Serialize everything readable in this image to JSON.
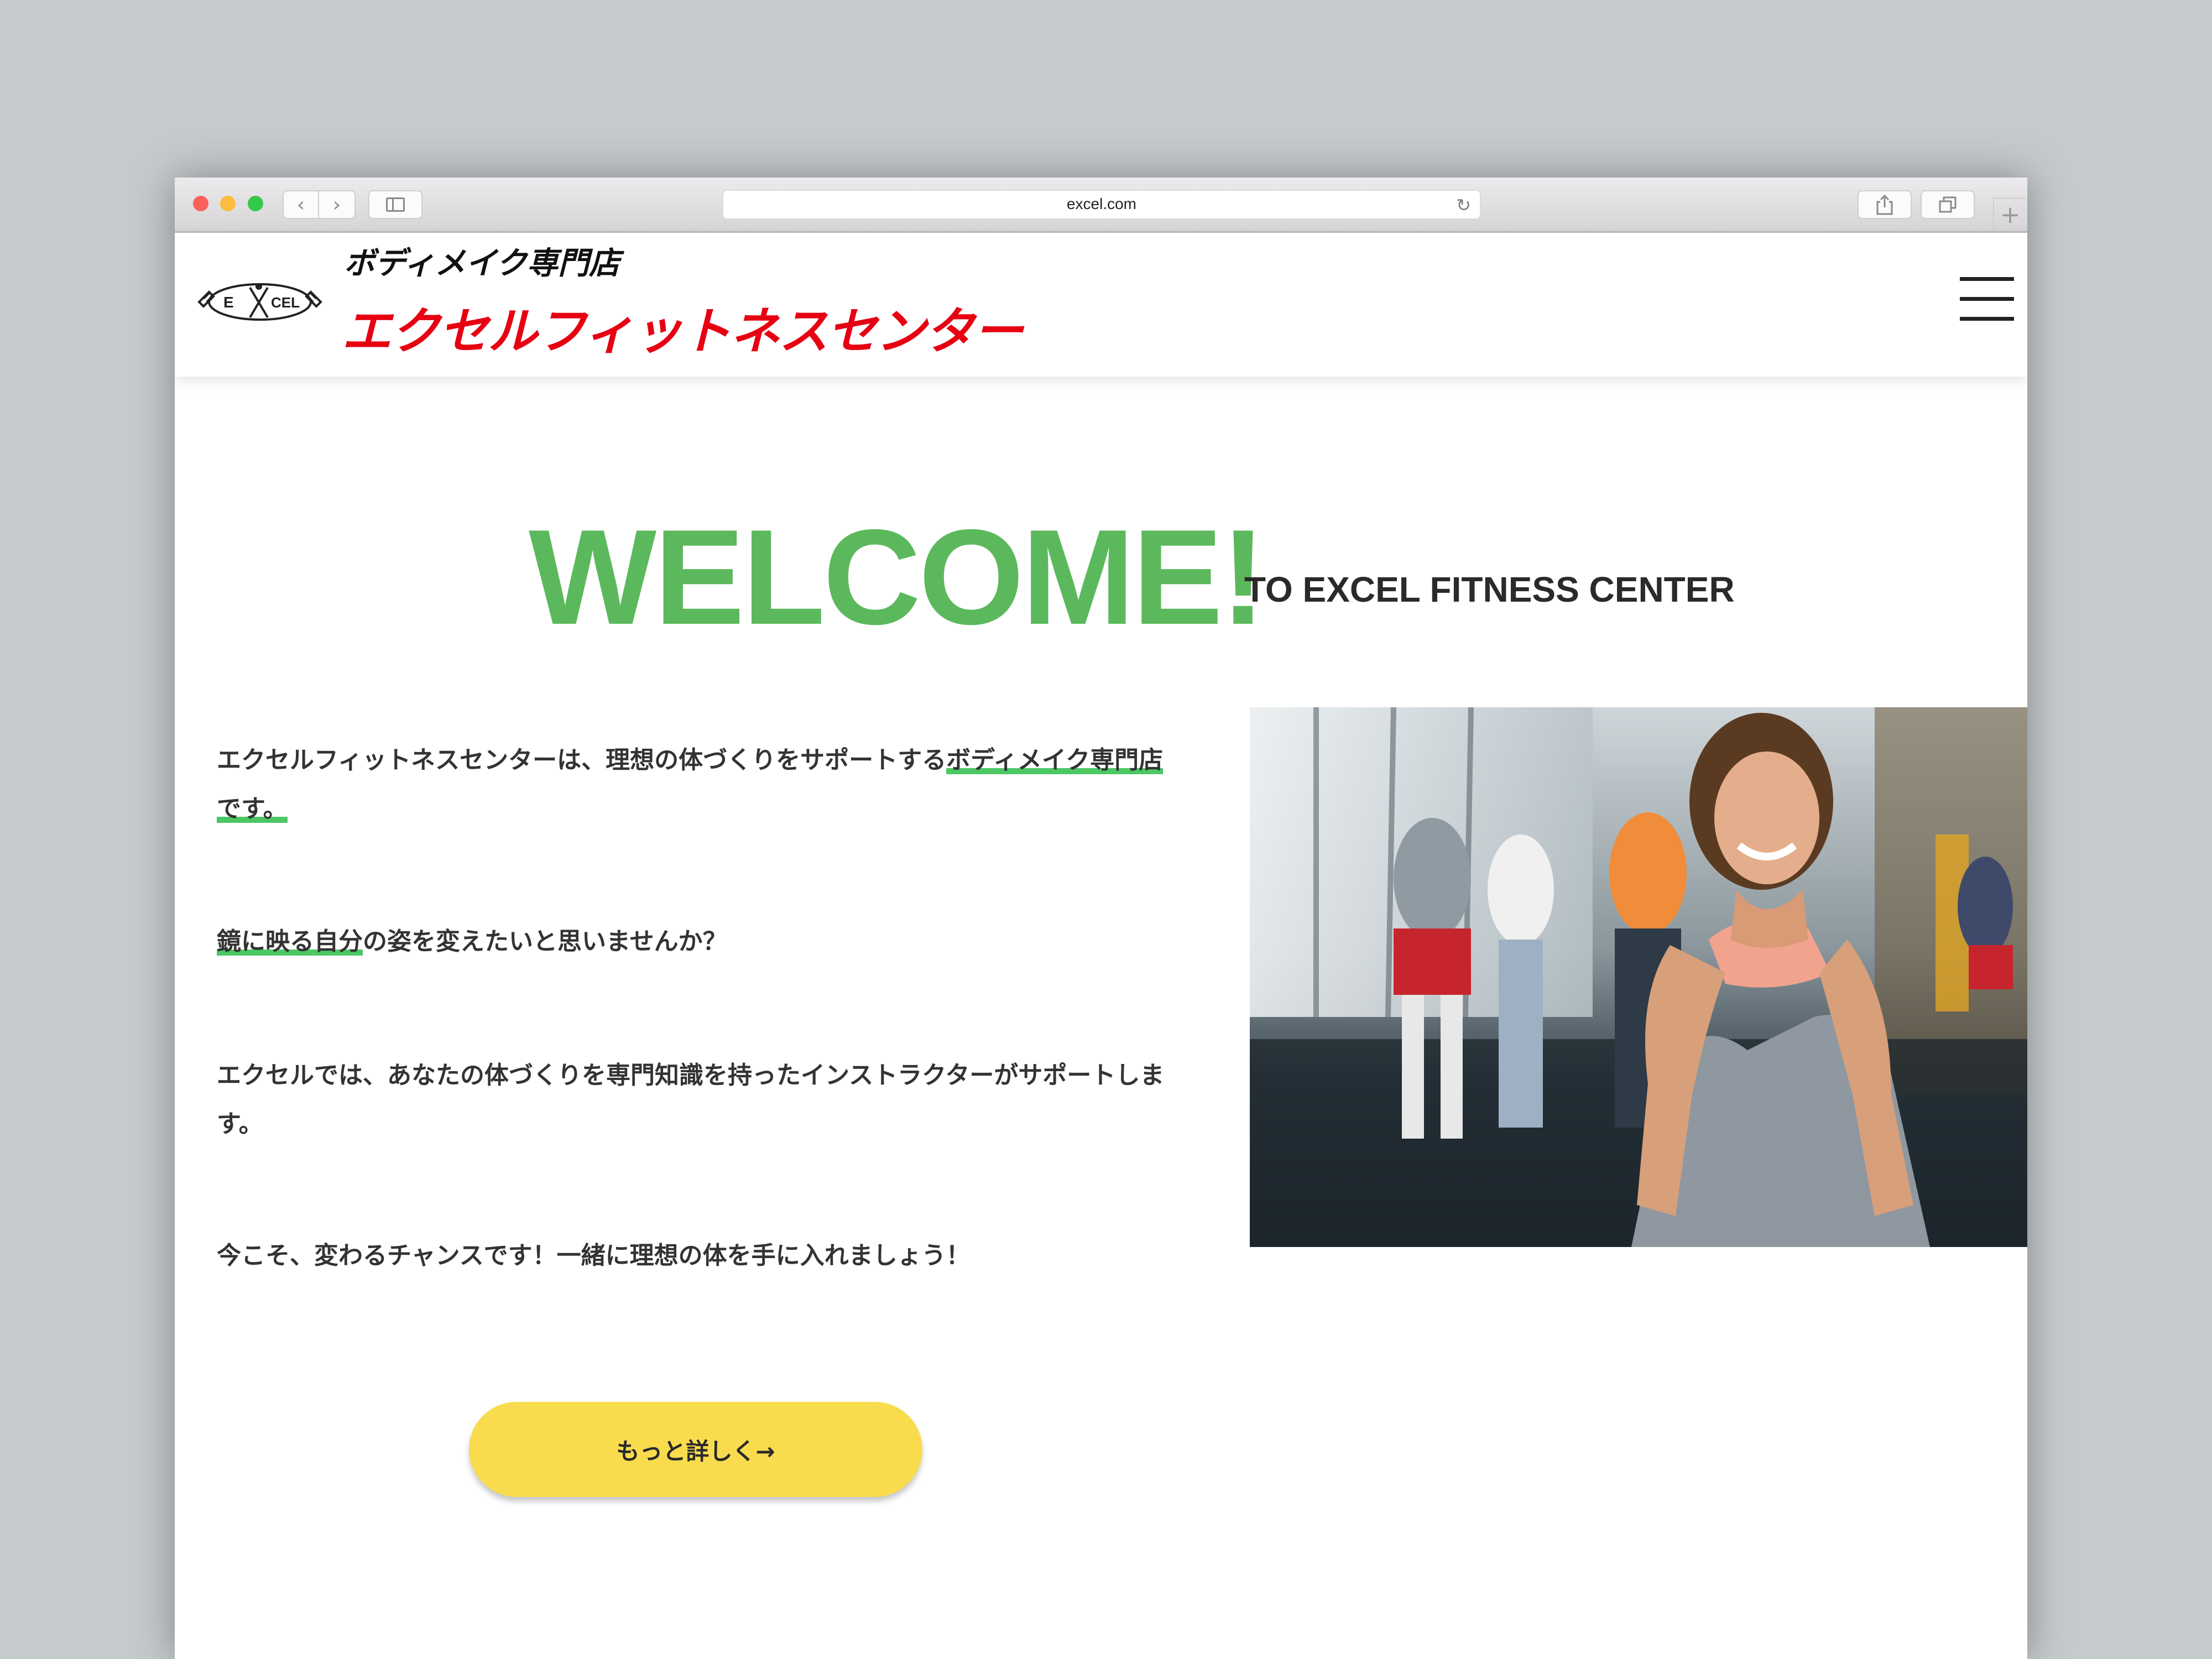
{
  "browser": {
    "url": "excel.com"
  },
  "header": {
    "logo_text": "E CEL",
    "tagline": "ボディメイク専門店",
    "brand_name": "エクセルフィットネスセンター",
    "brand_color": "#e60012"
  },
  "welcome": {
    "title": "WELCOME!",
    "subtitle": "TO EXCEL FITNESS CENTER",
    "title_color": "#5cb85c"
  },
  "intro": {
    "p1_before": "エクセルフィットネスセンターは、理想の体づくりをサポートする",
    "p1_highlight": "ボディメイク専門店です。",
    "p2_highlight": "鏡に映る自分",
    "p2_after": "の姿を変えたいと思いませんか？",
    "p3": "エクセルでは、あなたの体づくりを専門知識を持ったインストラクターがサポートします。",
    "p4": "今こそ、変わるチャンスです！一緒に理想の体を手に入れましょう！",
    "highlight_color": "#4cc764"
  },
  "cta": {
    "label": "もっと詳しく→",
    "color": "#f9dc4e"
  },
  "icons": [
    "back-icon",
    "forward-icon",
    "sidebar-icon",
    "reload-icon",
    "share-icon",
    "tabs-icon",
    "new-tab-icon",
    "menu-icon"
  ]
}
